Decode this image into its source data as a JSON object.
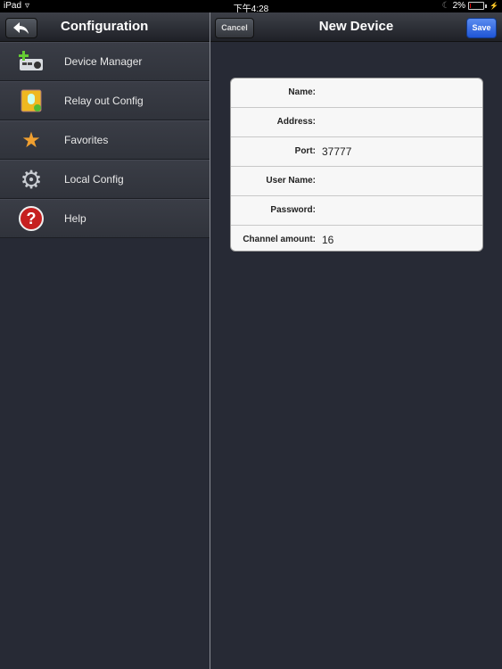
{
  "status_bar": {
    "device": "iPad",
    "time": "下午4:28",
    "battery": "2%"
  },
  "left_nav": {
    "title": "Configuration",
    "back_icon": "back-arrow-icon"
  },
  "right_nav": {
    "title": "New Device",
    "cancel_label": "Cancel",
    "save_label": "Save",
    "save_color": "#2f6ae0"
  },
  "sidebar": {
    "items": [
      {
        "label": "Device Manager",
        "icon": "device-manager-icon"
      },
      {
        "label": "Relay out Config",
        "icon": "relay-config-icon"
      },
      {
        "label": "Favorites",
        "icon": "star-icon"
      },
      {
        "label": "Local Config",
        "icon": "gear-icon"
      },
      {
        "label": "Help",
        "icon": "help-icon"
      }
    ]
  },
  "form": {
    "fields": [
      {
        "label": "Name:",
        "value": ""
      },
      {
        "label": "Address:",
        "value": ""
      },
      {
        "label": "Port:",
        "value": "37777"
      },
      {
        "label": "User Name:",
        "value": ""
      },
      {
        "label": "Password:",
        "value": ""
      },
      {
        "label": "Channel amount:",
        "value": "16"
      }
    ]
  }
}
